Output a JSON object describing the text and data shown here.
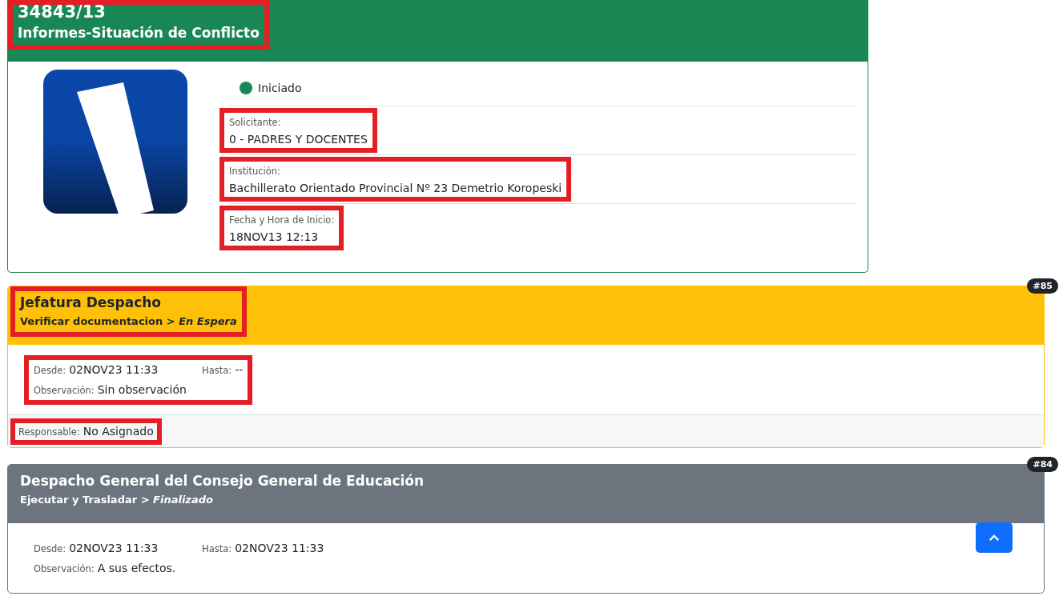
{
  "case": {
    "number": "34843/13",
    "title": "Informes-Situación de Conflicto",
    "header_highlighted": true,
    "status": {
      "label": "Iniciado",
      "color": "#198754"
    },
    "fields": [
      {
        "label": "Solicitante:",
        "value": "0 - PADRES Y DOCENTES",
        "highlighted": true
      },
      {
        "label": "Institución:",
        "value": "Bachillerato Orientado Provincial Nº 23 Demetrio Koropeski",
        "highlighted": true
      },
      {
        "label": "Fecha y Hora de Inicio:",
        "value": "18NOV13 12:13",
        "highlighted": true
      }
    ]
  },
  "steps": [
    {
      "badge": "#85",
      "kind": "warning",
      "office": "Jefatura Despacho",
      "task": "Verificar documentacion > *En Espera*",
      "header_highlighted": true,
      "from": {
        "label": "Desde:",
        "value": "02NOV23 11:33"
      },
      "to": {
        "label": "Hasta:",
        "value": "--"
      },
      "note": {
        "label": "Observación:",
        "value": "Sin observación"
      },
      "dates_highlighted": true,
      "responsible": {
        "label": "Responsable:",
        "value": "No Asignado",
        "highlighted": true
      }
    },
    {
      "badge": "#84",
      "kind": "secondary",
      "office": "Despacho General del Consejo General de Educación",
      "task": "Ejecutar y Trasladar > *Finalizado*",
      "header_highlighted": false,
      "from": {
        "label": "Desde:",
        "value": "02NOV23 11:33"
      },
      "to": {
        "label": "Hasta:",
        "value": "02NOV23 11:33"
      },
      "note": {
        "label": "Observación:",
        "value": "A sus efectos."
      },
      "dates_highlighted": false
    }
  ]
}
